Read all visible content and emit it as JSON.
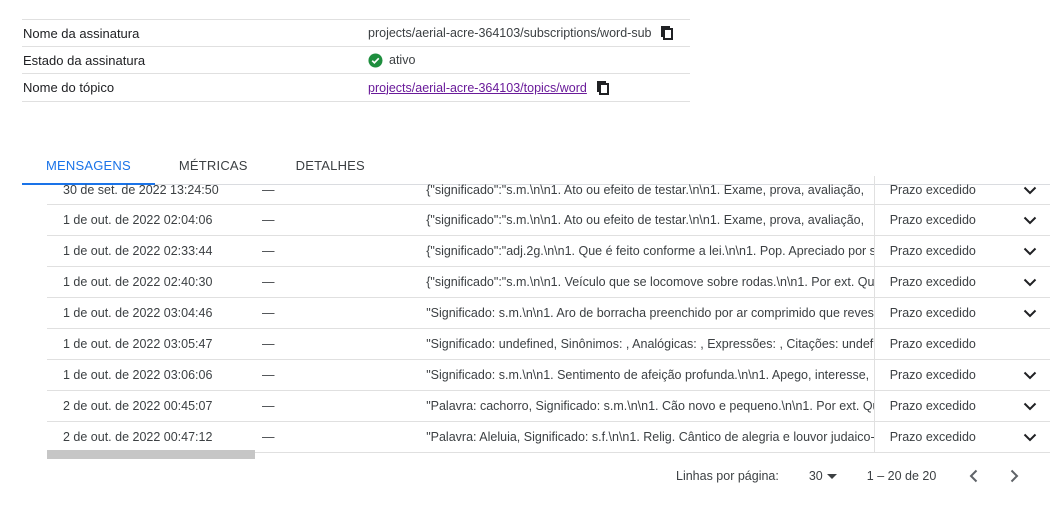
{
  "details": {
    "rows": [
      {
        "label": "Nome da assinatura",
        "value": "projects/aerial-acre-364103/subscriptions/word-sub"
      },
      {
        "label": "Estado da assinatura",
        "value": "ativo"
      },
      {
        "label": "Nome do tópico",
        "value": "projects/aerial-acre-364103/topics/word"
      }
    ]
  },
  "tabs": [
    {
      "label": "MENSAGENS",
      "active": true
    },
    {
      "label": "MÉTRICAS",
      "active": false
    },
    {
      "label": "DETALHES",
      "active": false
    }
  ],
  "messages": [
    {
      "date": "30 de set. de 2022 13:24:50",
      "attr": "—",
      "data": "{\"significado\":\"s.m.\\n\\n1. Ato ou efeito de testar.\\n\\n1. Exame, prova, avaliação,",
      "status": "Prazo excedido",
      "expand": true
    },
    {
      "date": "1 de out. de 2022 02:04:06",
      "attr": "—",
      "data": "{\"significado\":\"s.m.\\n\\n1. Ato ou efeito de testar.\\n\\n1. Exame, prova, avaliação,",
      "status": "Prazo excedido",
      "expand": true
    },
    {
      "date": "1 de out. de 2022 02:33:44",
      "attr": "—",
      "data": "{\"significado\":\"adj.2g.\\n\\n1. Que é feito conforme a lei.\\n\\n1. Pop. Apreciado por s",
      "status": "Prazo excedido",
      "expand": true
    },
    {
      "date": "1 de out. de 2022 02:40:30",
      "attr": "—",
      "data": "{\"significado\":\"s.m.\\n\\n1. Veículo que se locomove sobre rodas.\\n\\n1. Por ext. Qua",
      "status": "Prazo excedido",
      "expand": true
    },
    {
      "date": "1 de out. de 2022 03:04:46",
      "attr": "—",
      "data": "\"Significado: s.m.\\n\\n1. Aro de borracha preenchido por ar comprimido que revest",
      "status": "Prazo excedido",
      "expand": true
    },
    {
      "date": "1 de out. de 2022 03:05:47",
      "attr": "—",
      "data": "\"Significado: undefined, Sinônimos: , Analógicas: , Expressões: , Citações: undefir",
      "status": "Prazo excedido",
      "expand": false
    },
    {
      "date": "1 de out. de 2022 03:06:06",
      "attr": "—",
      "data": "\"Significado: s.m.\\n\\n1. Sentimento de afeição profunda.\\n\\n1. Apego, interesse,",
      "status": "Prazo excedido",
      "expand": true
    },
    {
      "date": "2 de out. de 2022 00:45:07",
      "attr": "—",
      "data": "\"Palavra: cachorro, Significado: s.m.\\n\\n1. Cão novo e pequeno.\\n\\n1. Por ext. Qu",
      "status": "Prazo excedido",
      "expand": true
    },
    {
      "date": "2 de out. de 2022 00:47:12",
      "attr": "—",
      "data": "\"Palavra: Aleluia, Significado: s.f.\\n\\n1. Relig. Cântico de alegria e louvor judaico-",
      "status": "Prazo excedido",
      "expand": true
    }
  ],
  "pagination": {
    "rows_per_page_label": "Linhas por página:",
    "rows_per_page": "30",
    "range": "1 – 20 de 20"
  },
  "icons": {
    "copy": "copy-icon",
    "status_ok": "check-circle-icon",
    "expand": "chevron-down-icon",
    "prev": "chevron-left-icon",
    "next": "chevron-right-icon"
  },
  "colors": {
    "accent": "#1a73e8",
    "ok_green": "#1e8e3e",
    "link": "#6a1b9a"
  }
}
